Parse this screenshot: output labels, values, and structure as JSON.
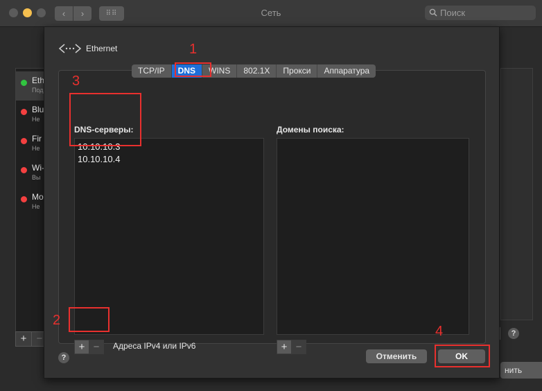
{
  "window": {
    "title": "Сеть",
    "search_placeholder": "Поиск",
    "nav_back": "‹",
    "nav_forward": "›",
    "grid_icon": "⠿⠿"
  },
  "network_list": [
    {
      "name": "Eth",
      "status": "Под",
      "status_color": "#31c540",
      "selected": true
    },
    {
      "name": "Blu",
      "status": "Не",
      "status_color": "#f44040",
      "selected": false
    },
    {
      "name": "Fir",
      "status": "Не",
      "status_color": "#f44040",
      "selected": false
    },
    {
      "name": "Wi-",
      "status": "Вы",
      "status_color": "#f44040",
      "selected": false
    },
    {
      "name": "Mo",
      "status": "Не",
      "status_color": "#f44040",
      "selected": false
    }
  ],
  "background_controls": {
    "plus": "+",
    "minus": "−",
    "help": "?",
    "apply_button_fragment": "нить"
  },
  "sheet": {
    "interface_name": "Ethernet",
    "tabs": [
      "TCP/IP",
      "DNS",
      "WINS",
      "802.1X",
      "Прокси",
      "Аппаратура"
    ],
    "active_tab": "DNS",
    "dns_label": "DNS-серверы:",
    "dns_servers": [
      "10.10.10.3",
      "10.10.10.4"
    ],
    "search_domains_label": "Домены поиска:",
    "search_domains": [],
    "plus": "+",
    "minus": "−",
    "address_hint": "Адреса IPv4 или IPv6",
    "help": "?",
    "cancel_label": "Отменить",
    "ok_label": "OK"
  },
  "annotations": {
    "color": "#e8302e",
    "labels": [
      "1",
      "2",
      "3",
      "4"
    ]
  }
}
